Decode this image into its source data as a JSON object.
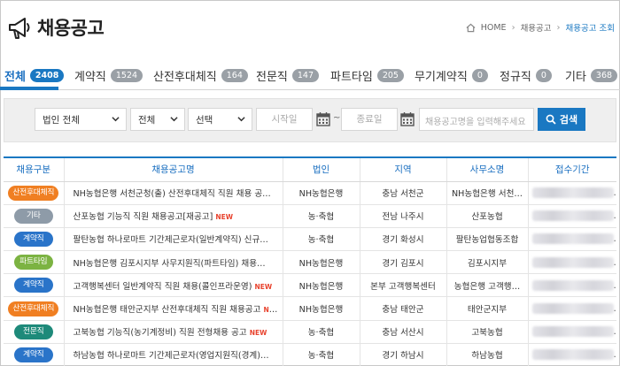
{
  "header": {
    "title": "채용공고",
    "icon": "megaphone-icon",
    "breadcrumb": [
      "HOME",
      "채용공고",
      "채용공고 조회"
    ]
  },
  "colors": {
    "accent": "#1a78c2",
    "badge_gray": "#9aa0a6",
    "new": "#e8432e",
    "tag_orange": "#f07f22",
    "tag_gray": "#8e9ba8",
    "tag_blue": "#2a74c9",
    "tag_green": "#7cb342",
    "tag_teal": "#1e8a7a"
  },
  "tabs": [
    {
      "label": "전체",
      "count": "2408",
      "active": true
    },
    {
      "label": "계약직",
      "count": "1524"
    },
    {
      "label": "산전후대체직",
      "count": "164"
    },
    {
      "label": "전문직",
      "count": "147"
    },
    {
      "label": "파트타임",
      "count": "205"
    },
    {
      "label": "무기계약직",
      "count": "0"
    },
    {
      "label": "정규직",
      "count": "0"
    },
    {
      "label": "기타",
      "count": "368"
    }
  ],
  "search": {
    "corp_select": "법인 전체",
    "type_select": "전체",
    "region_select": "선택",
    "start_placeholder": "시작일",
    "tilde": "~",
    "end_placeholder": "종료일",
    "keyword_placeholder": "채용공고명을 입력해주세요",
    "button_label": "검색"
  },
  "table": {
    "headers": [
      "채용구분",
      "채용공고명",
      "법인",
      "지역",
      "사무소명",
      "접수기간"
    ],
    "new_label": "NEW",
    "rows": [
      {
        "type": "산전후대체직",
        "tag_color": "#f07f22",
        "title": "NH농협은행 서천군청(출) 산전후대체직 직원 채용 공고",
        "new": true,
        "corp": "NH농협은행",
        "region": "충남 서천군",
        "office": "NH농협은행 서천…"
      },
      {
        "type": "기타",
        "tag_color": "#8e9ba8",
        "title": "산포농협 기능직 직원 채용공고[재공고]",
        "new": true,
        "corp": "농·축협",
        "region": "전남 나주시",
        "office": "산포농협"
      },
      {
        "type": "계약직",
        "tag_color": "#2a74c9",
        "title": "팔탄농협 하나로마트 기간제근로자(일반계약직) 신규…",
        "new": false,
        "corp": "농·축협",
        "region": "경기 화성시",
        "office": "팔탄농업협동조합"
      },
      {
        "type": "파트타임",
        "tag_color": "#7cb342",
        "title": "NH농협은행 김포시지부 사무지원직(파트타임) 채용…",
        "new": false,
        "corp": "NH농협은행",
        "region": "경기 김포시",
        "office": "김포시지부"
      },
      {
        "type": "계약직",
        "tag_color": "#2a74c9",
        "title": "고객행복센터 일반계약직 직원 채용(콜인프라운영)",
        "new": true,
        "corp": "NH농협은행",
        "region": "본부 고객행복센터",
        "office": "농협은행 고객행…"
      },
      {
        "type": "산전후대체직",
        "tag_color": "#f07f22",
        "title": "NH농협은행 태안군지부 산전후대체직 직원 채용공고",
        "new": true,
        "corp": "NH농협은행",
        "region": "충남 태안군",
        "office": "태안군지부"
      },
      {
        "type": "전문직",
        "tag_color": "#1e8a7a",
        "title": "고북농협 기능직(농기계정비) 직원 전형채용 공고",
        "new": true,
        "corp": "농·축협",
        "region": "충남 서산시",
        "office": "고북농협"
      },
      {
        "type": "계약직",
        "tag_color": "#2a74c9",
        "title": "하남농협 하나로마트 기간제근로자(영업지원직(경계)…",
        "new": false,
        "corp": "농·축협",
        "region": "경기 하남시",
        "office": "하남농협"
      }
    ]
  }
}
